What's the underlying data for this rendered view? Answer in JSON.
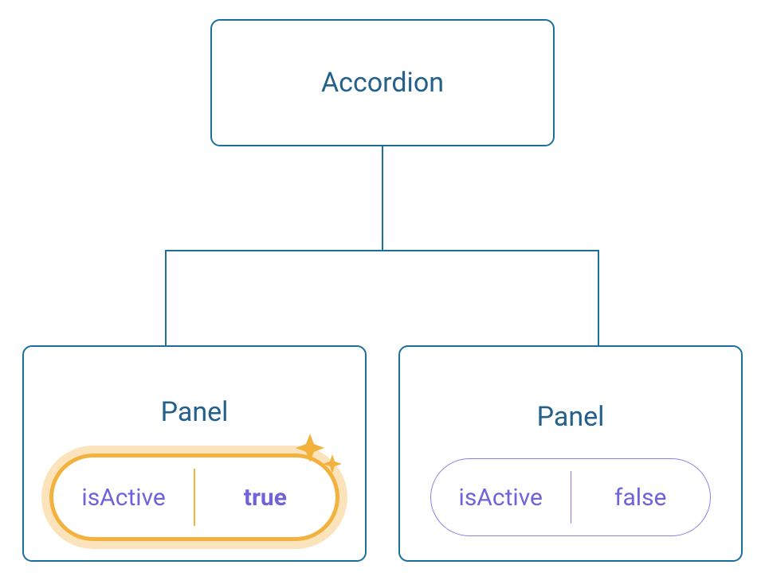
{
  "root": {
    "label": "Accordion"
  },
  "panels": [
    {
      "label": "Panel",
      "prop_name": "isActive",
      "prop_value": "true",
      "active": true
    },
    {
      "label": "Panel",
      "prop_name": "isActive",
      "prop_value": "false",
      "active": false
    }
  ],
  "colors": {
    "node_border": "#1b6f9c",
    "node_text": "#23608a",
    "pill_border": "#8a81e8",
    "pill_text": "#6f63da",
    "active_highlight": "#f3b23e"
  }
}
